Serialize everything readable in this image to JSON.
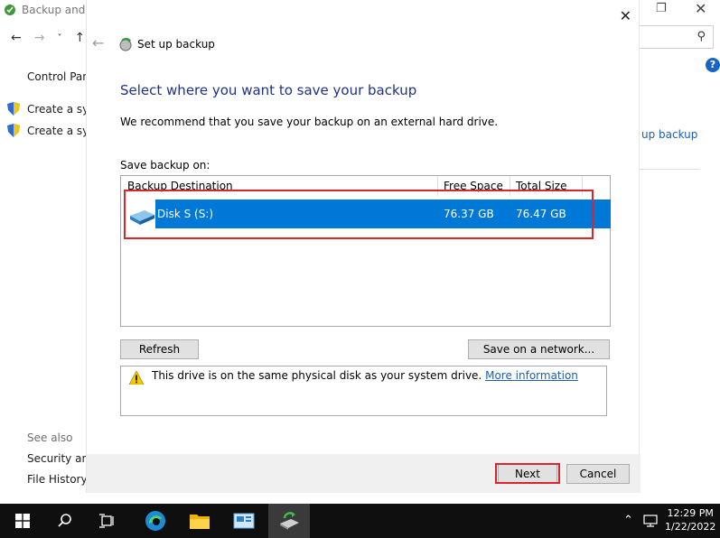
{
  "background_window": {
    "title": "Backup and F",
    "sidebar": {
      "control_panel": "Control Pan",
      "create_1": "Create a sys",
      "create_2": "Create a sys"
    },
    "right_link": "up backup",
    "see_also": {
      "heading": "See also",
      "security": "Security and",
      "file_history": "File History"
    }
  },
  "dialog": {
    "title": "Set up backup",
    "heading": "Select where you want to save your backup",
    "recommendation": "We recommend that you save your backup on an external hard drive.",
    "save_on_label": "Save backup on:",
    "columns": {
      "destination": "Backup Destination",
      "free_space": "Free Space",
      "total_size": "Total Size"
    },
    "destinations": [
      {
        "name": "Disk S (S:)",
        "free_space": "76.37 GB",
        "total_size": "76.47 GB"
      }
    ],
    "buttons": {
      "refresh": "Refresh",
      "save_network": "Save on a network...",
      "next": "Next",
      "cancel": "Cancel"
    },
    "warning": {
      "text": "This drive is on the same physical disk as your system drive.",
      "link": "More information"
    }
  },
  "taskbar": {
    "time": "12:29 PM",
    "date": "1/22/2022"
  },
  "colors": {
    "selection": "#0078d7",
    "heading": "#1e3287",
    "highlight": "#d9252c",
    "link": "#1a5fb4"
  }
}
